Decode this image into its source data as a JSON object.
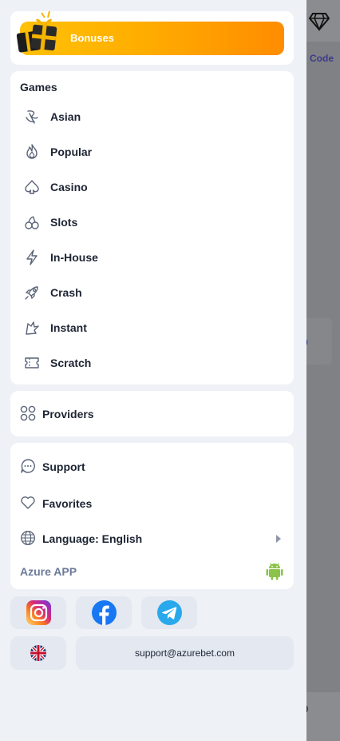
{
  "background": {
    "code_text": "Code",
    "card_text": "en",
    "support_text": "ort"
  },
  "bonuses": {
    "label": "Bonuses"
  },
  "games": {
    "title": "Games",
    "items": [
      {
        "label": "Asian",
        "icon": "asian-icon"
      },
      {
        "label": "Popular",
        "icon": "flame-icon"
      },
      {
        "label": "Casino",
        "icon": "spade-icon"
      },
      {
        "label": "Slots",
        "icon": "cherries-icon"
      },
      {
        "label": "In-House",
        "icon": "lightning-icon"
      },
      {
        "label": "Crash",
        "icon": "rocket-icon"
      },
      {
        "label": "Instant",
        "icon": "instant-icon"
      },
      {
        "label": "Scratch",
        "icon": "ticket-icon"
      }
    ]
  },
  "providers": {
    "label": "Providers"
  },
  "support_section": {
    "support_label": "Support",
    "favorites_label": "Favorites",
    "language_label": "Language: English",
    "app_label": "Azure APP"
  },
  "footer": {
    "email": "support@azurebet.com"
  },
  "colors": {
    "bonus_gradient_start": "#ffc107",
    "bonus_gradient_end": "#ff8c00",
    "android_green": "#8bc34a",
    "telegram_blue": "#29a9eb",
    "facebook_blue": "#1877f2"
  }
}
